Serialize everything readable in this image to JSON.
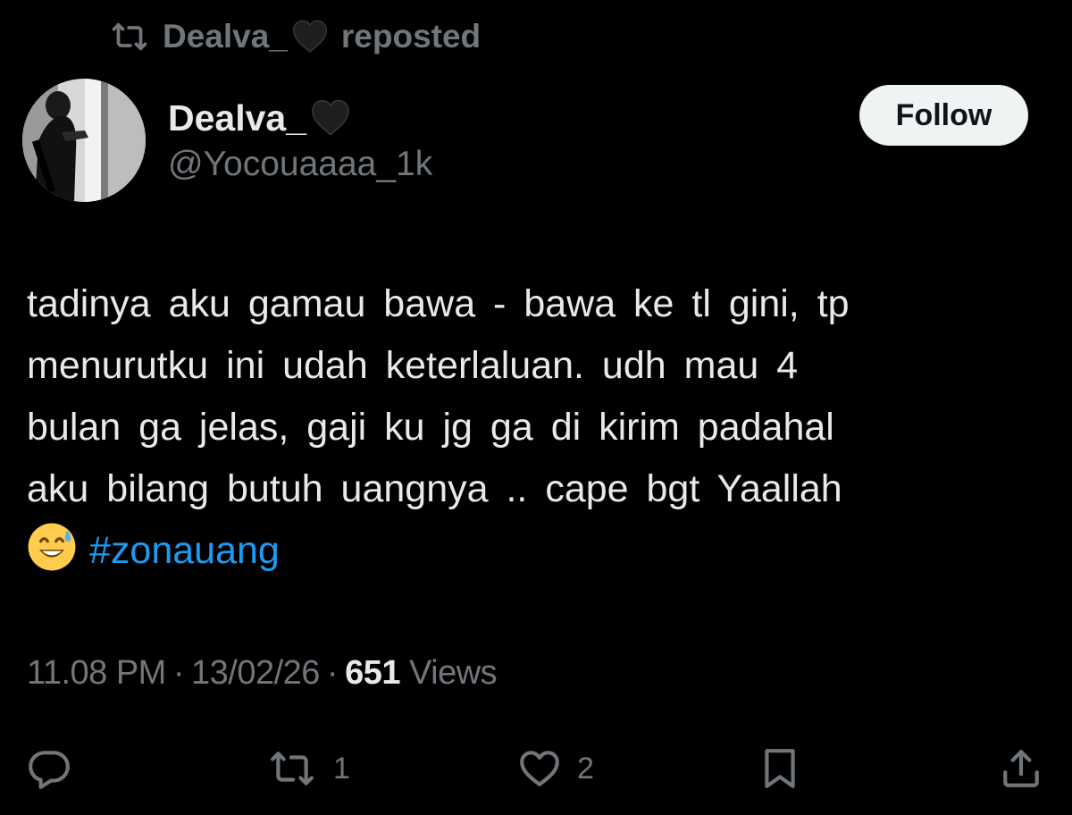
{
  "repost_banner": {
    "name": "Dealva_",
    "label": "reposted"
  },
  "author": {
    "display_name": "Dealva_",
    "handle": "@Yocouaaaa_1k"
  },
  "follow_button": {
    "label": "Follow"
  },
  "tweet": {
    "lines": [
      "tadinya aku gamau bawa - bawa ke tl gini, tp",
      "menurutku ini udah keterlaluan. udh mau 4",
      "bulan ga jelas, gaji ku jg ga di kirim padahal",
      "aku bilang butuh uangnya .. cape bgt Yaallah"
    ],
    "hashtag": "#zonauang"
  },
  "meta": {
    "time": "11.08 PM",
    "separator": "·",
    "date": "13/02/26",
    "views_count": "651",
    "views_label": "Views"
  },
  "actions": {
    "reply_count": "",
    "repost_count": "1",
    "like_count": "2"
  },
  "colors": {
    "background": "#000000",
    "text_primary": "#e7e9ea",
    "text_secondary": "#71767b",
    "link": "#1d9bf0",
    "follow_bg": "#eff3f4"
  },
  "icons": {
    "repost_banner": "repost-icon",
    "heart_emoji": "black-heart-emoji",
    "sweat_emoji": "grinning-sweat-emoji",
    "reply": "reply-icon",
    "repost": "repost-icon",
    "like": "like-icon",
    "bookmark": "bookmark-icon",
    "share": "share-icon"
  }
}
